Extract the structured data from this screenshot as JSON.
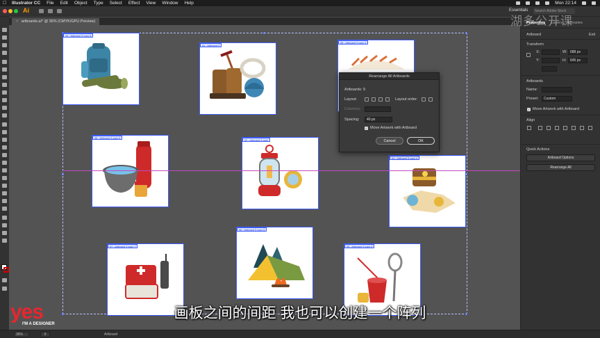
{
  "menubar": {
    "app_name": "Illustrator CC",
    "items": [
      "File",
      "Edit",
      "Object",
      "Type",
      "Select",
      "Effect",
      "View",
      "Window",
      "Help"
    ],
    "clock": "Mon 22:14"
  },
  "appbar": {
    "logo": "Ai",
    "workspace": "Essentials",
    "search_placeholder": "Search Adobe Stock"
  },
  "document": {
    "tab_label": "artboards.ai* @ 36% (CMYK/GPU Preview)",
    "close_glyph": "×"
  },
  "artboards": [
    {
      "label": "03 - Artboard 3 copy 8",
      "subject": "backpack"
    },
    {
      "label": "01 - Artboard 3",
      "subject": "boots-and-ice-axe"
    },
    {
      "label": "05 - Artboard 3 copy 3",
      "subject": "wagon"
    },
    {
      "label": "06 - Artboard 3 copy 6",
      "subject": "pot-and-thermos"
    },
    {
      "label": "02 - Artboard 3 copy",
      "subject": "lantern"
    },
    {
      "label": "04 - Artboard 3 copy 4",
      "subject": "treasure-map"
    },
    {
      "label": "07 - Artboard 3 copy 7",
      "subject": "first-aid-kit"
    },
    {
      "label": "08 - Artboard 3 copy 6",
      "subject": "tent-and-campfire"
    },
    {
      "label": "05 - Artboard 3 copy 5",
      "subject": "fishing-bucket"
    }
  ],
  "dialog": {
    "title": "Rearrange All Artboards",
    "artboards_label": "Artboards: 9",
    "layout_label": "Layout:",
    "layout_order_label": "Layout order:",
    "columns_label": "Columns:",
    "spacing_label": "Spacing:",
    "spacing_value": "40 px",
    "move_artwork_label": "Move Artwork with Artboard",
    "cancel_label": "Cancel",
    "ok_label": "OK"
  },
  "panel": {
    "tabs": [
      "Properties",
      "Layers",
      "Libraries"
    ],
    "section_artboard": "Artboard",
    "exit_label": "Exit",
    "transform_label": "Transform",
    "x_label": "X:",
    "y_label": "Y:",
    "w_label": "W:",
    "h_label": "H:",
    "w_value": "688 px",
    "h_value": "645 px",
    "artboards_label": "Artboards",
    "name_label": "Name:",
    "preset_label": "Preset:",
    "preset_value": "Custom",
    "move_artwork_label": "Move Artwork with Artboard",
    "align_label": "Align",
    "quick_actions_label": "Quick Actions",
    "artboard_options_label": "Artboard Options",
    "rearrange_all_label": "Rearrange All"
  },
  "statusbar": {
    "zoom": "36%",
    "page": "9",
    "tool": "Artboard"
  },
  "overlay": {
    "watermark": "湖多公开课",
    "subtitle": "画板之间的间距 我也可以创建一个阵列",
    "brand_main": "yes",
    "brand_sub": "I'M A DESIGNER"
  },
  "colors": {
    "accent_artboard": "#3d5cff",
    "guide": "#c448c4",
    "brand": "#e8262e"
  }
}
